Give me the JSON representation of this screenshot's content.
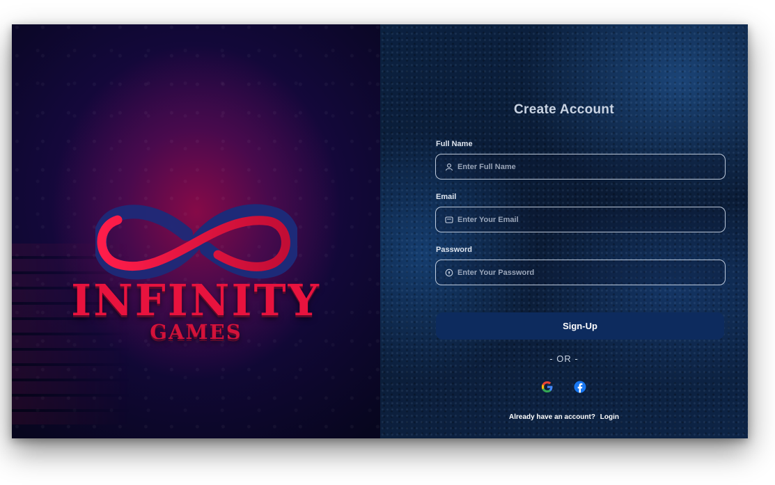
{
  "brand": {
    "title": "INFINITY",
    "subtitle": "GAMES"
  },
  "form": {
    "title": "Create Account",
    "full_name": {
      "label": "Full Name",
      "placeholder": "Enter Full Name",
      "icon": "user-icon"
    },
    "email": {
      "label": "Email",
      "placeholder": "Enter Your Email",
      "icon": "mail-icon"
    },
    "password": {
      "label": "Password",
      "placeholder": "Enter Your Password",
      "icon": "lock-icon"
    },
    "signup_label": "Sign-Up",
    "or_text": "- OR -",
    "social": [
      {
        "name": "google",
        "icon": "google-icon"
      },
      {
        "name": "facebook",
        "icon": "facebook-icon"
      }
    ],
    "footer_prompt": "Already have an account?",
    "login_label": "Login"
  },
  "colors": {
    "brand_red": "#e8133e",
    "button_bg": "#0d2b5e",
    "facebook_blue": "#1877f2"
  }
}
